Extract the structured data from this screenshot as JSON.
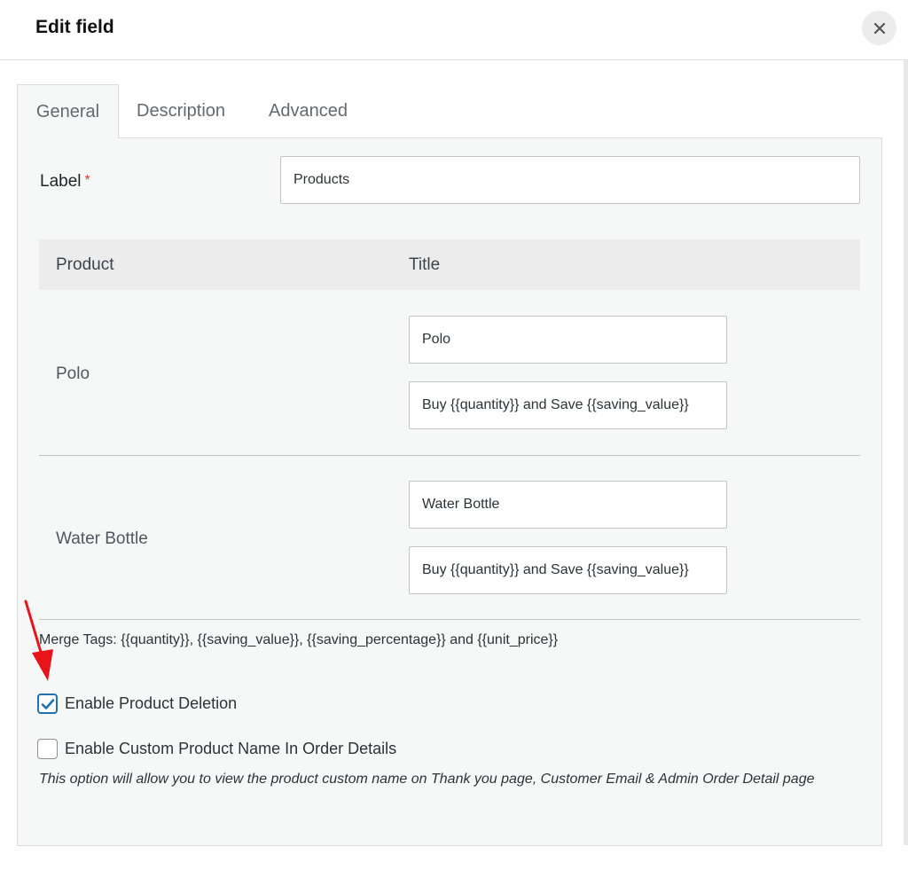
{
  "modal": {
    "title": "Edit field",
    "close_icon": "close-icon"
  },
  "tabs": [
    {
      "label": "General",
      "active": true
    },
    {
      "label": "Description",
      "active": false
    },
    {
      "label": "Advanced",
      "active": false
    }
  ],
  "general": {
    "label_field": {
      "label": "Label",
      "required_marker": "*",
      "value": "Products"
    },
    "table": {
      "headers": [
        "Product",
        "Title"
      ],
      "rows": [
        {
          "product": "Polo",
          "title_value": "Polo",
          "offer_value": "Buy {{quantity}} and Save {{saving_value}}"
        },
        {
          "product": "Water Bottle",
          "title_value": "Water Bottle",
          "offer_value": "Buy {{quantity}} and Save {{saving_value}}"
        }
      ]
    },
    "merge_tags": "Merge Tags: {{quantity}}, {{saving_value}}, {{saving_percentage}} and {{unit_price}}",
    "options": [
      {
        "label": "Enable Product Deletion",
        "checked": true
      },
      {
        "label": "Enable Custom Product Name In Order Details",
        "checked": false
      }
    ],
    "help_text": "This option will allow you to view the product custom name on Thank you page, Customer Email & Admin Order Detail page"
  },
  "colors": {
    "accent": "#2271b1",
    "required": "#d63638",
    "annotation_arrow": "#e8141b",
    "panel_bg": "#f6f7f7"
  }
}
